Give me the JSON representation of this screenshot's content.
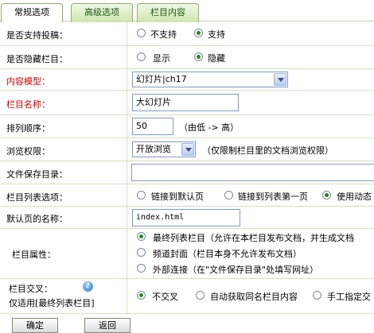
{
  "tabs": [
    {
      "label": "常规选项"
    },
    {
      "label": "高级选项"
    },
    {
      "label": "栏目内容"
    }
  ],
  "form": {
    "allow_submit": {
      "label": "是否支持投稿：",
      "options": [
        "不支持",
        "支持"
      ],
      "selected": 1
    },
    "hide_column": {
      "label": "是否隐藏栏目：",
      "options": [
        "显示",
        "隐藏"
      ],
      "selected": 1
    },
    "content_model": {
      "label": "内容模型：",
      "value": "幻灯片|ch17"
    },
    "column_name": {
      "label": "栏目名称：",
      "value": "大幻灯片"
    },
    "sort_order": {
      "label": "排列顺序：",
      "value": "50",
      "hint": "（由低 -> 高）"
    },
    "browse_permission": {
      "label": "浏览权限：",
      "value": "开放浏览",
      "hint": "（仅限制栏目里的文档浏览权限）"
    },
    "save_dir": {
      "label": "文件保存目录：",
      "value": ""
    },
    "list_option": {
      "label": "栏目列表选项：",
      "options": [
        "链接到默认页",
        "链接到列表第一页",
        "使用动态"
      ],
      "selected": 2
    },
    "default_page": {
      "label": "默认页的名称：",
      "value": "index.html"
    },
    "column_attr": {
      "label": "栏目属性：",
      "options": [
        "最终列表栏目（允许在本栏目发布文档，并生成文档",
        "频道封面（栏目本身不允许发布文档）",
        "外部连接（在\"文件保存目录\"处填写网址）"
      ],
      "selected": 0
    },
    "cross_column": {
      "label": "栏目交叉：",
      "sublabel": "仅适用[最终列表栏目]",
      "options": [
        "不交叉",
        "自动获取同名栏目内容",
        "手工指定交"
      ],
      "selected": 0
    }
  },
  "buttons": {
    "confirm": "确定",
    "back": "返回"
  }
}
